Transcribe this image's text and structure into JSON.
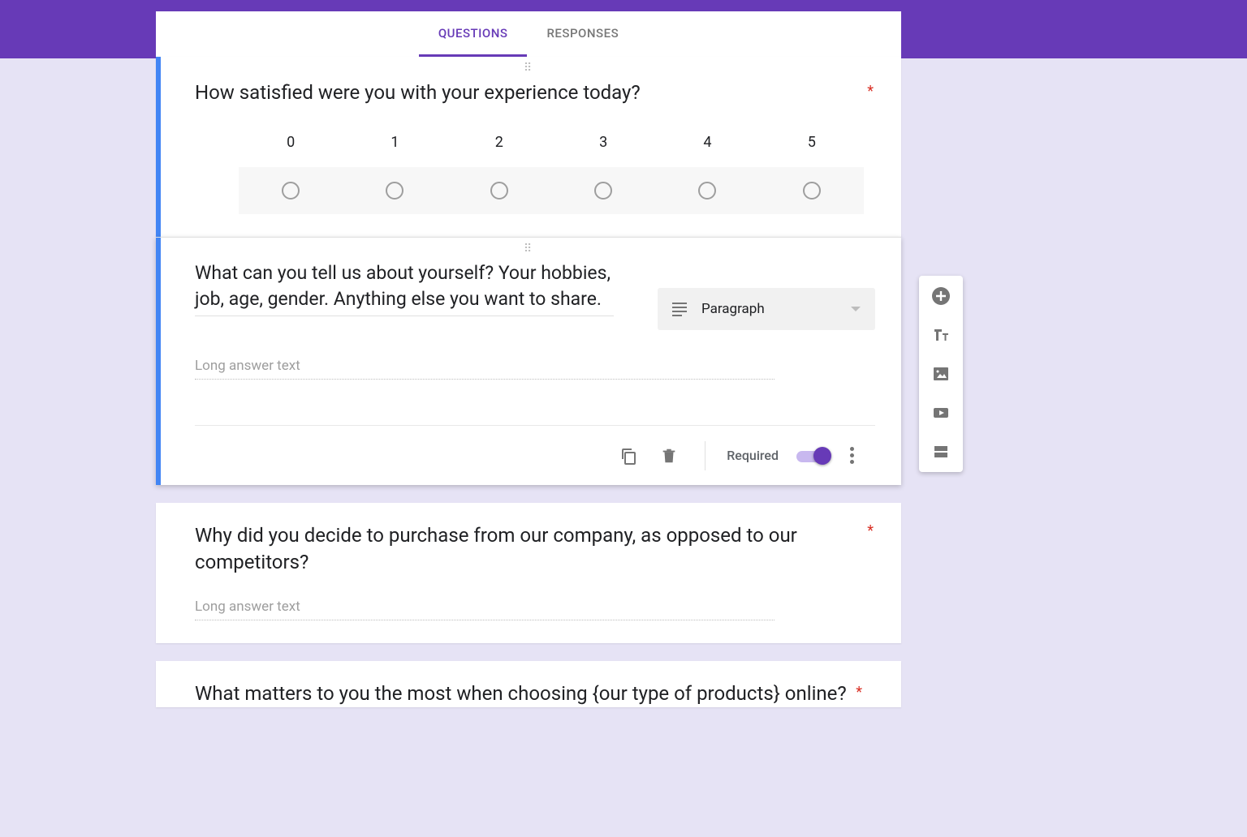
{
  "tabs": {
    "questions": "QUESTIONS",
    "responses": "RESPONSES"
  },
  "q1": {
    "text": "How satisfied were you with your experience today?",
    "scale": [
      "0",
      "1",
      "2",
      "3",
      "4",
      "5"
    ]
  },
  "q2": {
    "text": "What can you tell us about yourself? Your hobbies, job, age, gender. Anything else you want to share.",
    "type_label": "Paragraph",
    "answer_placeholder": "Long answer text",
    "required_label": "Required"
  },
  "q3": {
    "text": "Why did you decide to purchase from our company, as opposed to our competitors?",
    "answer_placeholder": "Long answer text"
  },
  "q4": {
    "text": "What matters to you the most when choosing {our type of products} online?"
  }
}
